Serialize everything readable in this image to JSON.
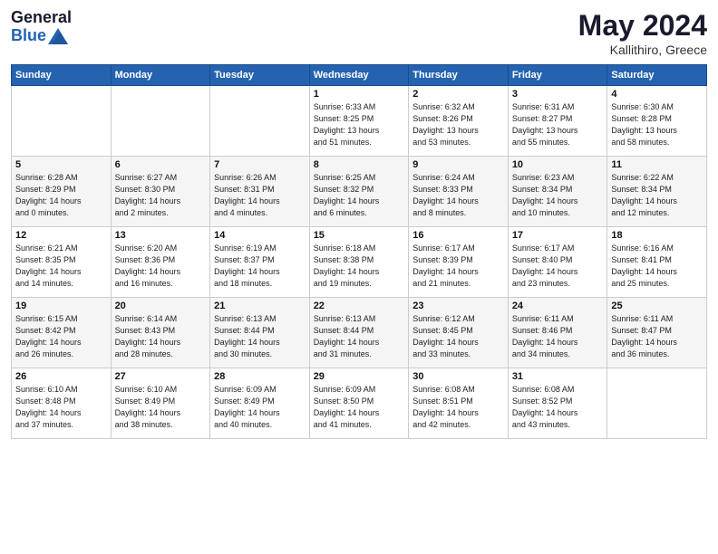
{
  "header": {
    "logo_general": "General",
    "logo_blue": "Blue",
    "month_year": "May 2024",
    "location": "Kallithiro, Greece"
  },
  "days_of_week": [
    "Sunday",
    "Monday",
    "Tuesday",
    "Wednesday",
    "Thursday",
    "Friday",
    "Saturday"
  ],
  "weeks": [
    [
      {
        "day": "",
        "info": ""
      },
      {
        "day": "",
        "info": ""
      },
      {
        "day": "",
        "info": ""
      },
      {
        "day": "1",
        "info": "Sunrise: 6:33 AM\nSunset: 8:25 PM\nDaylight: 13 hours\nand 51 minutes."
      },
      {
        "day": "2",
        "info": "Sunrise: 6:32 AM\nSunset: 8:26 PM\nDaylight: 13 hours\nand 53 minutes."
      },
      {
        "day": "3",
        "info": "Sunrise: 6:31 AM\nSunset: 8:27 PM\nDaylight: 13 hours\nand 55 minutes."
      },
      {
        "day": "4",
        "info": "Sunrise: 6:30 AM\nSunset: 8:28 PM\nDaylight: 13 hours\nand 58 minutes."
      }
    ],
    [
      {
        "day": "5",
        "info": "Sunrise: 6:28 AM\nSunset: 8:29 PM\nDaylight: 14 hours\nand 0 minutes."
      },
      {
        "day": "6",
        "info": "Sunrise: 6:27 AM\nSunset: 8:30 PM\nDaylight: 14 hours\nand 2 minutes."
      },
      {
        "day": "7",
        "info": "Sunrise: 6:26 AM\nSunset: 8:31 PM\nDaylight: 14 hours\nand 4 minutes."
      },
      {
        "day": "8",
        "info": "Sunrise: 6:25 AM\nSunset: 8:32 PM\nDaylight: 14 hours\nand 6 minutes."
      },
      {
        "day": "9",
        "info": "Sunrise: 6:24 AM\nSunset: 8:33 PM\nDaylight: 14 hours\nand 8 minutes."
      },
      {
        "day": "10",
        "info": "Sunrise: 6:23 AM\nSunset: 8:34 PM\nDaylight: 14 hours\nand 10 minutes."
      },
      {
        "day": "11",
        "info": "Sunrise: 6:22 AM\nSunset: 8:34 PM\nDaylight: 14 hours\nand 12 minutes."
      }
    ],
    [
      {
        "day": "12",
        "info": "Sunrise: 6:21 AM\nSunset: 8:35 PM\nDaylight: 14 hours\nand 14 minutes."
      },
      {
        "day": "13",
        "info": "Sunrise: 6:20 AM\nSunset: 8:36 PM\nDaylight: 14 hours\nand 16 minutes."
      },
      {
        "day": "14",
        "info": "Sunrise: 6:19 AM\nSunset: 8:37 PM\nDaylight: 14 hours\nand 18 minutes."
      },
      {
        "day": "15",
        "info": "Sunrise: 6:18 AM\nSunset: 8:38 PM\nDaylight: 14 hours\nand 19 minutes."
      },
      {
        "day": "16",
        "info": "Sunrise: 6:17 AM\nSunset: 8:39 PM\nDaylight: 14 hours\nand 21 minutes."
      },
      {
        "day": "17",
        "info": "Sunrise: 6:17 AM\nSunset: 8:40 PM\nDaylight: 14 hours\nand 23 minutes."
      },
      {
        "day": "18",
        "info": "Sunrise: 6:16 AM\nSunset: 8:41 PM\nDaylight: 14 hours\nand 25 minutes."
      }
    ],
    [
      {
        "day": "19",
        "info": "Sunrise: 6:15 AM\nSunset: 8:42 PM\nDaylight: 14 hours\nand 26 minutes."
      },
      {
        "day": "20",
        "info": "Sunrise: 6:14 AM\nSunset: 8:43 PM\nDaylight: 14 hours\nand 28 minutes."
      },
      {
        "day": "21",
        "info": "Sunrise: 6:13 AM\nSunset: 8:44 PM\nDaylight: 14 hours\nand 30 minutes."
      },
      {
        "day": "22",
        "info": "Sunrise: 6:13 AM\nSunset: 8:44 PM\nDaylight: 14 hours\nand 31 minutes."
      },
      {
        "day": "23",
        "info": "Sunrise: 6:12 AM\nSunset: 8:45 PM\nDaylight: 14 hours\nand 33 minutes."
      },
      {
        "day": "24",
        "info": "Sunrise: 6:11 AM\nSunset: 8:46 PM\nDaylight: 14 hours\nand 34 minutes."
      },
      {
        "day": "25",
        "info": "Sunrise: 6:11 AM\nSunset: 8:47 PM\nDaylight: 14 hours\nand 36 minutes."
      }
    ],
    [
      {
        "day": "26",
        "info": "Sunrise: 6:10 AM\nSunset: 8:48 PM\nDaylight: 14 hours\nand 37 minutes."
      },
      {
        "day": "27",
        "info": "Sunrise: 6:10 AM\nSunset: 8:49 PM\nDaylight: 14 hours\nand 38 minutes."
      },
      {
        "day": "28",
        "info": "Sunrise: 6:09 AM\nSunset: 8:49 PM\nDaylight: 14 hours\nand 40 minutes."
      },
      {
        "day": "29",
        "info": "Sunrise: 6:09 AM\nSunset: 8:50 PM\nDaylight: 14 hours\nand 41 minutes."
      },
      {
        "day": "30",
        "info": "Sunrise: 6:08 AM\nSunset: 8:51 PM\nDaylight: 14 hours\nand 42 minutes."
      },
      {
        "day": "31",
        "info": "Sunrise: 6:08 AM\nSunset: 8:52 PM\nDaylight: 14 hours\nand 43 minutes."
      },
      {
        "day": "",
        "info": ""
      }
    ]
  ]
}
